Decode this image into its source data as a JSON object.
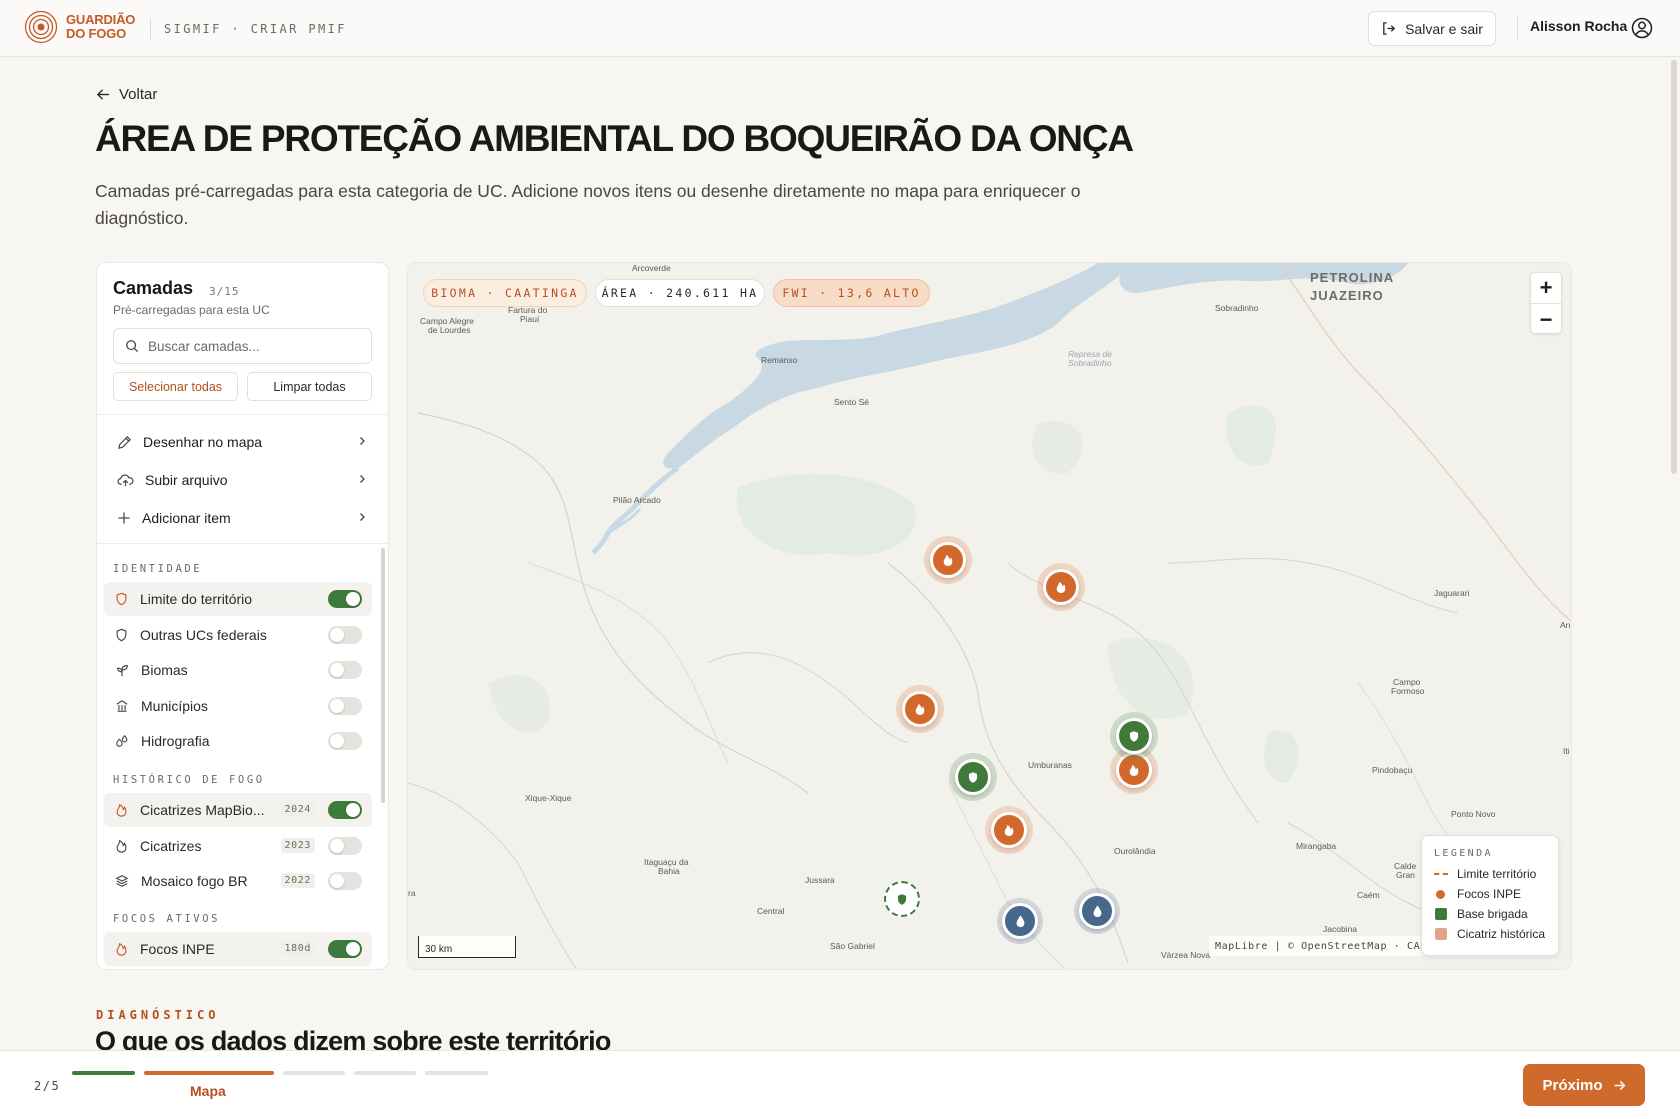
{
  "header": {
    "logo_line1": "GUARDIÃO",
    "logo_line2": "DO FOGO",
    "breadcrumb": "SIGMIF · CRIAR PMIF",
    "save_exit_label": "Salvar e sair",
    "user_name": "Alisson Rocha"
  },
  "page": {
    "back_label": "Voltar",
    "title": "ÁREA DE PROTEÇÃO AMBIENTAL DO BOQUEIRÃO DA ONÇA",
    "description": "Camadas pré-carregadas para esta categoria de UC. Adicione novos itens ou desenhe diretamente no mapa para enriquecer o diagnóstico."
  },
  "layers_panel": {
    "title": "Camadas",
    "count": "3/15",
    "subtitle": "Pré-carregadas para esta UC",
    "search_placeholder": "Buscar camadas...",
    "select_all": "Selecionar todas",
    "clear_all": "Limpar todas",
    "actions": [
      {
        "label": "Desenhar no mapa",
        "icon": "pencil-icon"
      },
      {
        "label": "Subir arquivo",
        "icon": "cloud-upload-icon"
      },
      {
        "label": "Adicionar item",
        "icon": "plus-icon"
      }
    ],
    "groups": [
      {
        "label": "IDENTIDADE",
        "items": [
          {
            "label": "Limite do território",
            "icon": "shield-icon",
            "on": true
          },
          {
            "label": "Outras UCs federais",
            "icon": "shield-icon",
            "on": false
          },
          {
            "label": "Biomas",
            "icon": "sprout-icon",
            "on": false
          },
          {
            "label": "Municípios",
            "icon": "building-icon",
            "on": false
          },
          {
            "label": "Hidrografia",
            "icon": "droplets-icon",
            "on": false
          }
        ]
      },
      {
        "label": "HISTÓRICO DE FOGO",
        "items": [
          {
            "label": "Cicatrizes MapBio...",
            "icon": "flame-icon",
            "year": "2024",
            "on": true
          },
          {
            "label": "Cicatrizes",
            "icon": "flame-icon",
            "year": "2023",
            "on": false
          },
          {
            "label": "Mosaico fogo BR",
            "icon": "layers-icon",
            "year": "2022",
            "on": false
          }
        ]
      },
      {
        "label": "FOCOS ATIVOS",
        "items": [
          {
            "label": "Focos INPE",
            "icon": "flame-icon",
            "year": "180d",
            "on": true
          }
        ]
      }
    ]
  },
  "map": {
    "chips": {
      "bioma": "BIOMA · CAATINGA",
      "area": "ÁREA · 240.611 HA",
      "fwi": "FWI · 13,6 ALTO"
    },
    "zoom_in": "+",
    "zoom_out": "−",
    "scale_label": "30 km",
    "attribution": "MapLibre | © OpenStreetMap · CAR",
    "region_label_1": "PETROLINA",
    "region_label_2": "JUAZEIRO",
    "place_labels": {
      "arcoverde": "Arcoverde",
      "campo_alegre_1": "Campo Alegre",
      "campo_alegre_2": "de Lourdes",
      "fartura_1": "Fartura do",
      "fartura_2": "Piauí",
      "sobradinho": "Sobradinho",
      "represa_1": "Represa de",
      "represa_2": "Sobradinho",
      "remanso": "Remanso",
      "sento_se": "Sento Sé",
      "pilao_arcado": "Pilão Arcado",
      "jaguarari": "Jaguarari",
      "an": "An",
      "campo_formoso_1": "Campo",
      "campo_formoso_2": "Formoso",
      "iti": "Iti",
      "umburanas": "Umburanas",
      "pindobacu": "Pindobaçu",
      "xique_xique": "Xique-Xique",
      "ponto_novo": "Ponto Novo",
      "ourolandia": "Ourolândia",
      "mirangaba": "Mirangaba",
      "caldeirao_1": "Calde",
      "caldeirao_2": "Gran",
      "itaguacu_1": "Itaguaçu da",
      "itaguacu_2": "Bahia",
      "jussara": "Jussara",
      "caem": "Caém",
      "central": "Central",
      "jacobina": "Jacobina",
      "sao_gabriel": "São Gabriel",
      "varzea_nova": "Várzea Nova",
      "ra": "ra"
    },
    "legend": {
      "title": "LEGENDA",
      "items": [
        {
          "label": "Limite território",
          "swatch": "dashed-line",
          "color": "#d46a2c"
        },
        {
          "label": "Focos INPE",
          "swatch": "dot",
          "color": "#d46a2c"
        },
        {
          "label": "Base brigada",
          "swatch": "square",
          "color": "#3f7a3b"
        },
        {
          "label": "Cicatriz histórica",
          "swatch": "square",
          "color": "#e0a48c"
        }
      ]
    }
  },
  "diagnostics": {
    "kicker": "DIAGNÓSTICO",
    "title": "O que os dados dizem sobre este território"
  },
  "footer": {
    "step_count": "2/5",
    "current_step": "Mapa",
    "total_steps": 5,
    "completed_steps": 1,
    "next_label": "Próximo"
  },
  "colors": {
    "accent": "#cf6a2c",
    "brand": "#c45a25",
    "toggle_on": "#3e7a3b",
    "water": "#c9d9e3"
  }
}
